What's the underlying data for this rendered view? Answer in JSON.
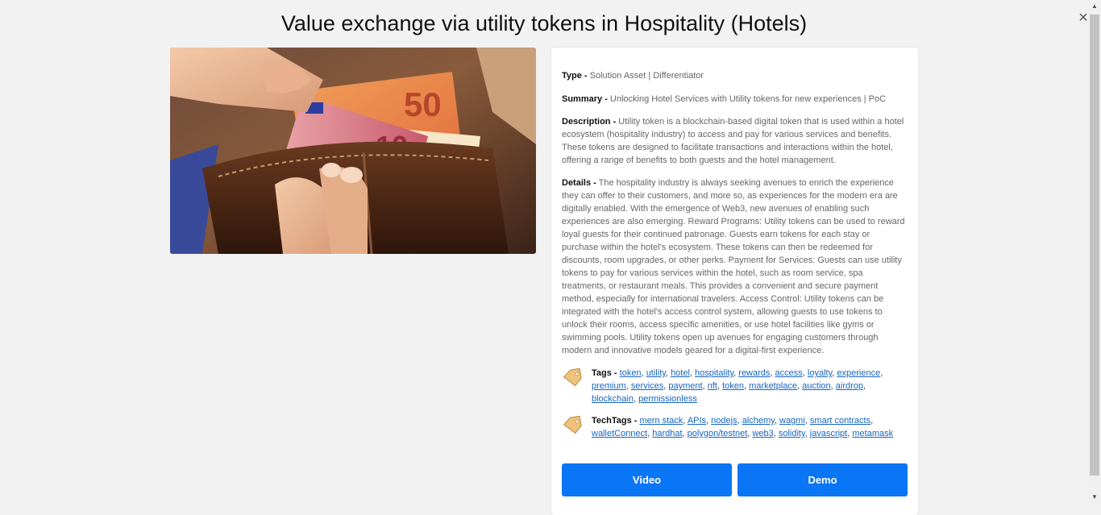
{
  "page": {
    "title": "Value exchange via utility tokens in Hospitality (Hotels)"
  },
  "close_icon": "×",
  "scrollbar": {
    "up": "▲",
    "down": "▼"
  },
  "image": {
    "alt_subject": "wallet-with-euro-banknotes"
  },
  "details": {
    "type_label": "Type -",
    "type_value": " Solution Asset | Differentiator",
    "summary_label": "Summary -",
    "summary_value": " Unlocking Hotel Services with Utility tokens for new experiences | PoC",
    "description_label": "Description -",
    "description_value": " Utility token is a blockchain-based digital token that is used within a hotel ecosystem (hospitality industry) to access and pay for various services and benefits. These tokens are designed to facilitate transactions and interactions within the hotel, offering a range of benefits to both guests and the hotel management.",
    "details_label": "Details -",
    "details_value": " The hospitality industry is always seeking avenues to enrich the experience they can offer to their customers, and more so, as experiences for the modern era are digitally enabled. With the emergence of Web3, new avenues of enabling such experiences are also emerging. Reward Programs: Utility tokens can be used to reward loyal guests for their continued patronage. Guests earn tokens for each stay or purchase within the hotel's ecosystem. These tokens can then be redeemed for discounts, room upgrades, or other perks. Payment for Services: Guests can use utility tokens to pay for various services within the hotel, such as room service, spa treatments, or restaurant meals. This provides a convenient and secure payment method, especially for international travelers. Access Control: Utility tokens can be integrated with the hotel's access control system, allowing guests to use tokens to unlock their rooms, access specific amenities, or use hotel facilities like gyms or swimming pools. Utility tokens open up avenues for engaging customers through modern and innovative models geared for a digital-first experience."
  },
  "tags": {
    "label": "Tags -",
    "icon": "tag-icon",
    "items": [
      "token",
      "utility",
      "hotel",
      "hospitality",
      "rewards",
      "access",
      "loyalty",
      "experience",
      "premium",
      "services",
      "payment",
      "nft",
      "token",
      "marketplace",
      "auction",
      "airdrop",
      "blockchain",
      "permissionless"
    ]
  },
  "techtags": {
    "label": "TechTags -",
    "icon": "tag-icon",
    "items": [
      "mern stack",
      "APIs",
      "nodejs",
      "alchemy",
      "wagmi",
      "smart contracts",
      "walletConnect",
      "hardhat",
      "polygon/testnet",
      "web3",
      "solidity",
      "javascript",
      "metamask"
    ]
  },
  "buttons": {
    "video": "Video",
    "demo": "Demo"
  },
  "colors": {
    "accent": "#0a75f5",
    "link": "#1565c0",
    "tag_icon": "#f0c27b"
  }
}
